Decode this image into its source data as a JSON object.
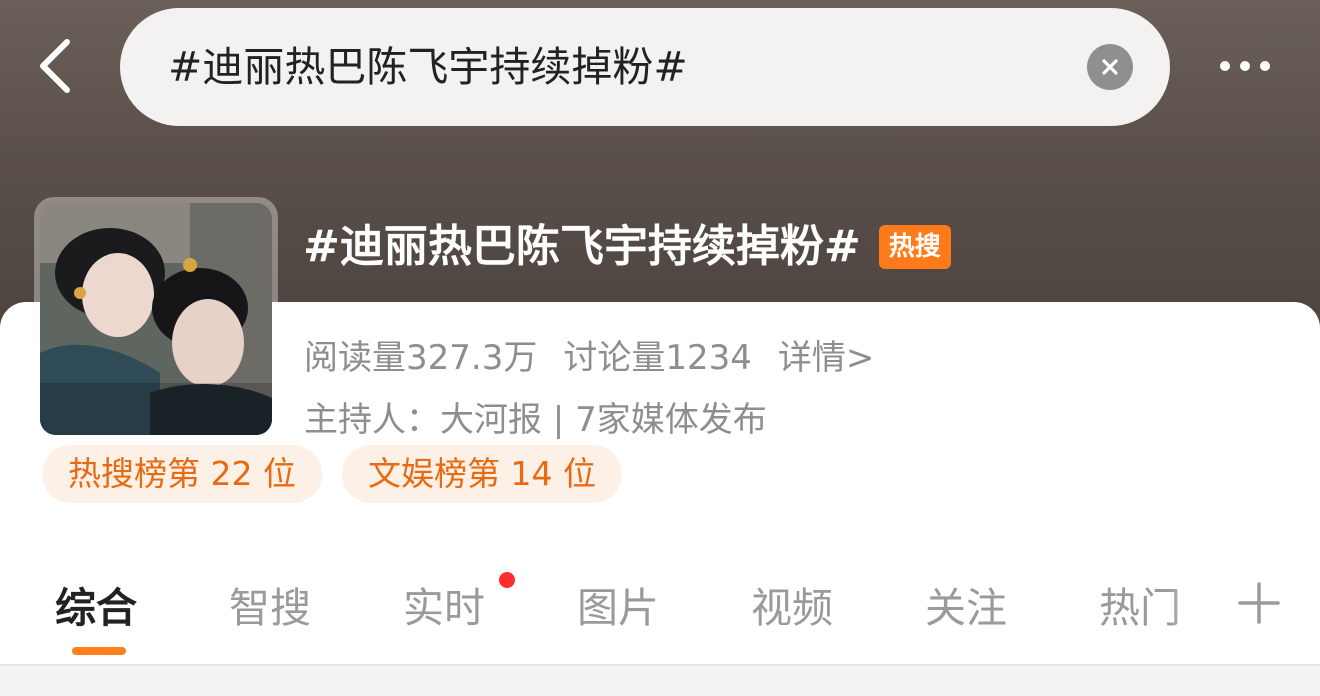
{
  "header": {
    "search_query": "#迪丽热巴陈飞宇持续掉粉#",
    "back_icon": "chevron-left-icon",
    "clear_icon": "clear-circle-icon",
    "more_icon": "more-horizontal-icon"
  },
  "topic": {
    "title": "#迪丽热巴陈飞宇持续掉粉#",
    "badge": "热搜",
    "reads": "阅读量327.3万",
    "discussions": "讨论量1234",
    "details_link": "详情>",
    "host_line": "主持人：大河报 | 7家媒体发布",
    "rank_tags": [
      "热搜榜第 22 位",
      "文娱榜第 14 位"
    ]
  },
  "tabs": [
    {
      "label": "综合"
    },
    {
      "label": "智搜"
    },
    {
      "label": "实时"
    },
    {
      "label": "图片"
    },
    {
      "label": "视频"
    },
    {
      "label": "关注"
    },
    {
      "label": "热门"
    }
  ],
  "colors": {
    "accent": "#ff7a1a",
    "badge_bg": "#ff7a1a",
    "tag_bg": "#fdf0e6",
    "tag_text": "#e86a12",
    "red_dot": "#ff2d2d"
  }
}
